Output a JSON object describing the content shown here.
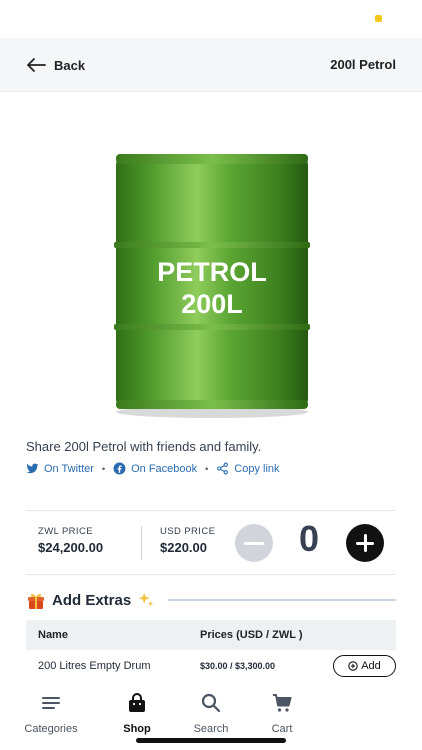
{
  "header": {
    "back_label": "Back",
    "title": "200l Petrol"
  },
  "product": {
    "image_text_line1": "PETROL",
    "image_text_line2": "200L"
  },
  "share": {
    "text": "Share 200l Petrol with friends and family.",
    "twitter": "On Twitter",
    "facebook": "On Facebook",
    "copy": "Copy link",
    "separator": "•"
  },
  "pricing": {
    "zwl_label": "ZWL PRICE",
    "zwl_value": "$24,200.00",
    "usd_label": "USD PRICE",
    "usd_value": "$220.00",
    "quantity": "0"
  },
  "extras": {
    "title": "Add Extras",
    "columns": {
      "name": "Name",
      "prices": "Prices (USD / ZWL )"
    },
    "rows": [
      {
        "name": "200 Litres Empty Drum",
        "price": "$30.00 / $3,300.00",
        "add_label": "Add"
      }
    ]
  },
  "nav": {
    "items": [
      {
        "label": "Categories",
        "icon": "menu-icon"
      },
      {
        "label": "Shop",
        "icon": "shopping-bag-icon"
      },
      {
        "label": "Search",
        "icon": "search-icon"
      },
      {
        "label": "Cart",
        "icon": "cart-icon"
      }
    ],
    "active": "Shop"
  },
  "colors": {
    "drum_green": "#4f9a2c",
    "link_blue": "#2b6cb0",
    "status_dot": "#f5c518"
  }
}
